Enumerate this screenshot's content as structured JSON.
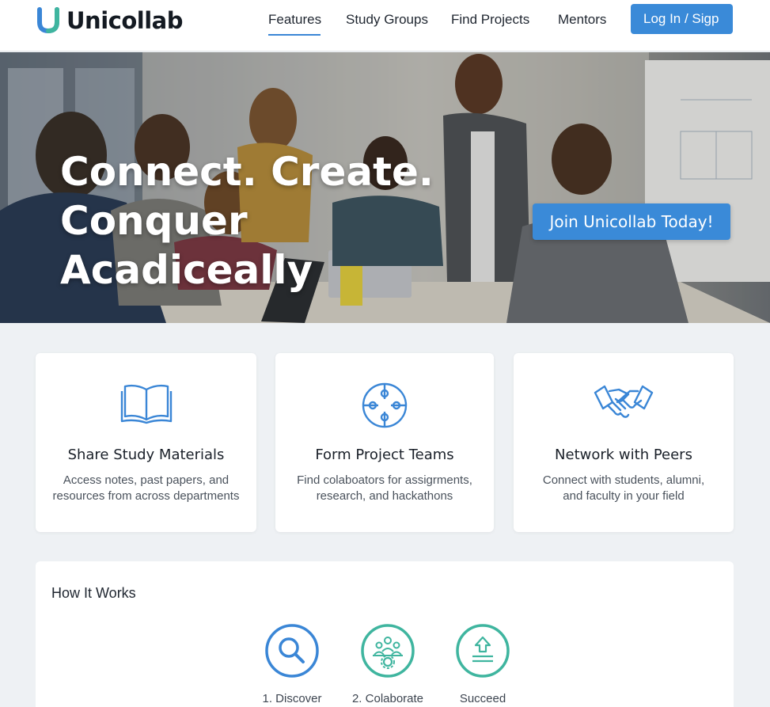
{
  "brand": {
    "name": "Unicollab"
  },
  "nav": {
    "links": [
      "Features",
      "Study Groups",
      "Find Projects",
      "Mentors"
    ],
    "active": "Features",
    "login_label": "Log In / Sigp"
  },
  "hero": {
    "headline_line1": "Connect. Create. Conquer",
    "headline_line2": "Acadiceally",
    "cta_label": "Join Unicollab Today!"
  },
  "features": [
    {
      "icon": "book-icon",
      "title": "Share Study Materials",
      "desc_line1": "Access notes, past papers, and",
      "desc_line2": "resources from across departments"
    },
    {
      "icon": "puzzle-icon",
      "title": "Form Project Teams",
      "desc_line1": "Find colaboators for assigrments,",
      "desc_line2": "research, and hackathons"
    },
    {
      "icon": "handshake-icon",
      "title": "Network with Peers",
      "desc_line1": "Connect with students, alumni,",
      "desc_line2": "and faculty in your field"
    }
  ],
  "how_it_works": {
    "title": "How It Works",
    "steps": [
      {
        "icon": "magnifier-icon",
        "label": "1. Discover"
      },
      {
        "icon": "team-gear-icon",
        "label": "2. Colaborate"
      },
      {
        "icon": "upload-icon",
        "label": "Succeed"
      }
    ]
  },
  "colors": {
    "accent": "#3a8ad8",
    "teal": "#3fb59f",
    "icon_blue": "#3a86d6"
  }
}
